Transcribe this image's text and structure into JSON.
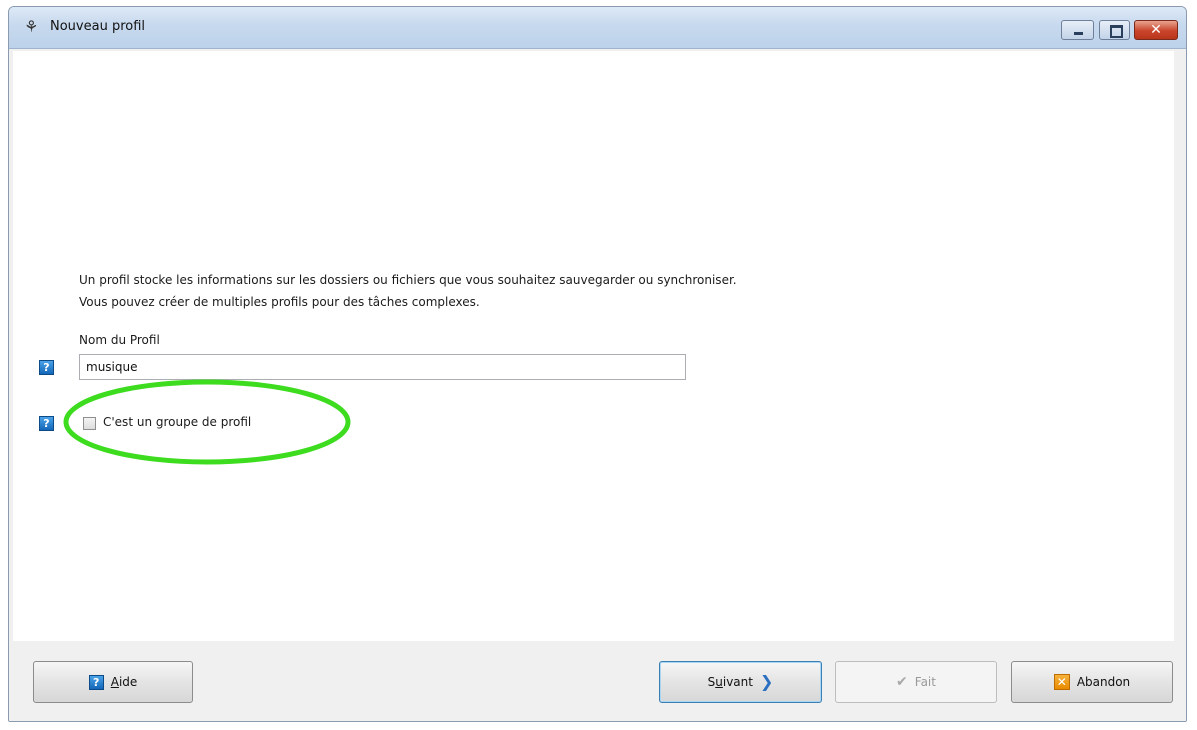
{
  "window": {
    "title": "Nouveau profil",
    "controls": {
      "minimize": "minimize-icon",
      "maximize": "maximize-icon",
      "close": "close-icon"
    }
  },
  "main": {
    "intro_line1": "Un profil stocke les informations sur les dossiers ou fichiers que vous souhaitez sauvegarder ou synchroniser.",
    "intro_line2": "Vous pouvez créer de multiples profils pour des tâches complexes.",
    "profile_name": {
      "label": "Nom du Profil",
      "value": "musique"
    },
    "group_checkbox": {
      "label": "C'est un groupe de profil",
      "checked": false
    },
    "help_icon_text": "?",
    "highlight_color": "#3ddc1f"
  },
  "footer": {
    "help": {
      "prefix": "A",
      "rest": "ide"
    },
    "next": {
      "prefix": "S",
      "underlined": "u",
      "rest": "ivant"
    },
    "done": {
      "label": "Fait"
    },
    "cancel": {
      "label": "Abandon"
    }
  }
}
